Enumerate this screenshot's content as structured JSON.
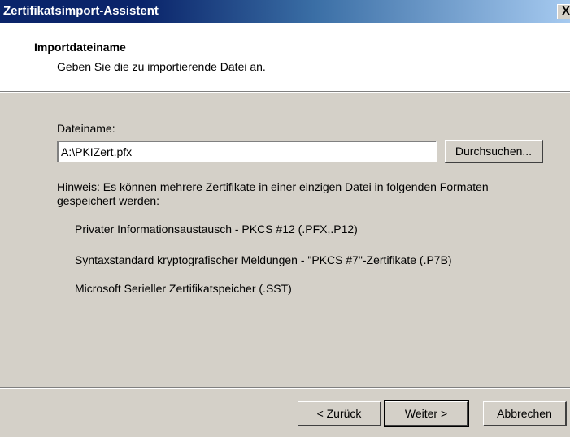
{
  "window": {
    "title": "Zertifikatsimport-Assistent",
    "close_glyph": "X"
  },
  "header": {
    "title": "Importdateiname",
    "subtitle": "Geben Sie die zu importierende Datei an."
  },
  "form": {
    "filename_label": "Dateiname:",
    "filename_value": "A:\\PKIZert.pfx",
    "browse_label": "Durchsuchen...",
    "hint": "Hinweis: Es können mehrere Zertifikate in einer einzigen Datei in folgenden Formaten gespeichert werden:",
    "formats": [
      "Privater Informationsaustausch - PKCS #12 (.PFX,.P12)",
      "Syntaxstandard kryptografischer Meldungen - \"PKCS #7\"-Zertifikate (.P7B)",
      "Microsoft Serieller Zertifikatspeicher (.SST)"
    ]
  },
  "footer": {
    "back_label": "< Zurück",
    "next_label": "Weiter >",
    "cancel_label": "Abbrechen"
  },
  "colors": {
    "titlebar_start": "#0a246a",
    "titlebar_end": "#a6caf0",
    "face": "#d4d0c8"
  }
}
